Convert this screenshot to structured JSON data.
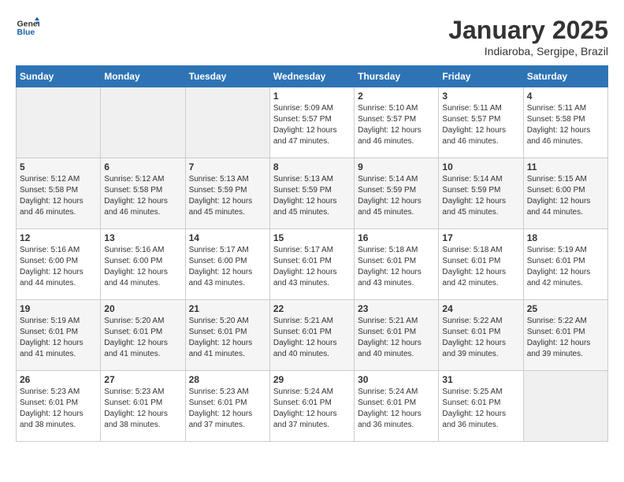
{
  "logo": {
    "text_general": "General",
    "text_blue": "Blue"
  },
  "title": "January 2025",
  "subtitle": "Indiaroba, Sergipe, Brazil",
  "days_of_week": [
    "Sunday",
    "Monday",
    "Tuesday",
    "Wednesday",
    "Thursday",
    "Friday",
    "Saturday"
  ],
  "weeks": [
    [
      {
        "day": "",
        "sunrise": "",
        "sunset": "",
        "daylight": "",
        "empty": true
      },
      {
        "day": "",
        "sunrise": "",
        "sunset": "",
        "daylight": "",
        "empty": true
      },
      {
        "day": "",
        "sunrise": "",
        "sunset": "",
        "daylight": "",
        "empty": true
      },
      {
        "day": "1",
        "sunrise": "Sunrise: 5:09 AM",
        "sunset": "Sunset: 5:57 PM",
        "daylight": "Daylight: 12 hours and 47 minutes.",
        "empty": false
      },
      {
        "day": "2",
        "sunrise": "Sunrise: 5:10 AM",
        "sunset": "Sunset: 5:57 PM",
        "daylight": "Daylight: 12 hours and 46 minutes.",
        "empty": false
      },
      {
        "day": "3",
        "sunrise": "Sunrise: 5:11 AM",
        "sunset": "Sunset: 5:57 PM",
        "daylight": "Daylight: 12 hours and 46 minutes.",
        "empty": false
      },
      {
        "day": "4",
        "sunrise": "Sunrise: 5:11 AM",
        "sunset": "Sunset: 5:58 PM",
        "daylight": "Daylight: 12 hours and 46 minutes.",
        "empty": false
      }
    ],
    [
      {
        "day": "5",
        "sunrise": "Sunrise: 5:12 AM",
        "sunset": "Sunset: 5:58 PM",
        "daylight": "Daylight: 12 hours and 46 minutes.",
        "empty": false
      },
      {
        "day": "6",
        "sunrise": "Sunrise: 5:12 AM",
        "sunset": "Sunset: 5:58 PM",
        "daylight": "Daylight: 12 hours and 46 minutes.",
        "empty": false
      },
      {
        "day": "7",
        "sunrise": "Sunrise: 5:13 AM",
        "sunset": "Sunset: 5:59 PM",
        "daylight": "Daylight: 12 hours and 45 minutes.",
        "empty": false
      },
      {
        "day": "8",
        "sunrise": "Sunrise: 5:13 AM",
        "sunset": "Sunset: 5:59 PM",
        "daylight": "Daylight: 12 hours and 45 minutes.",
        "empty": false
      },
      {
        "day": "9",
        "sunrise": "Sunrise: 5:14 AM",
        "sunset": "Sunset: 5:59 PM",
        "daylight": "Daylight: 12 hours and 45 minutes.",
        "empty": false
      },
      {
        "day": "10",
        "sunrise": "Sunrise: 5:14 AM",
        "sunset": "Sunset: 5:59 PM",
        "daylight": "Daylight: 12 hours and 45 minutes.",
        "empty": false
      },
      {
        "day": "11",
        "sunrise": "Sunrise: 5:15 AM",
        "sunset": "Sunset: 6:00 PM",
        "daylight": "Daylight: 12 hours and 44 minutes.",
        "empty": false
      }
    ],
    [
      {
        "day": "12",
        "sunrise": "Sunrise: 5:16 AM",
        "sunset": "Sunset: 6:00 PM",
        "daylight": "Daylight: 12 hours and 44 minutes.",
        "empty": false
      },
      {
        "day": "13",
        "sunrise": "Sunrise: 5:16 AM",
        "sunset": "Sunset: 6:00 PM",
        "daylight": "Daylight: 12 hours and 44 minutes.",
        "empty": false
      },
      {
        "day": "14",
        "sunrise": "Sunrise: 5:17 AM",
        "sunset": "Sunset: 6:00 PM",
        "daylight": "Daylight: 12 hours and 43 minutes.",
        "empty": false
      },
      {
        "day": "15",
        "sunrise": "Sunrise: 5:17 AM",
        "sunset": "Sunset: 6:01 PM",
        "daylight": "Daylight: 12 hours and 43 minutes.",
        "empty": false
      },
      {
        "day": "16",
        "sunrise": "Sunrise: 5:18 AM",
        "sunset": "Sunset: 6:01 PM",
        "daylight": "Daylight: 12 hours and 43 minutes.",
        "empty": false
      },
      {
        "day": "17",
        "sunrise": "Sunrise: 5:18 AM",
        "sunset": "Sunset: 6:01 PM",
        "daylight": "Daylight: 12 hours and 42 minutes.",
        "empty": false
      },
      {
        "day": "18",
        "sunrise": "Sunrise: 5:19 AM",
        "sunset": "Sunset: 6:01 PM",
        "daylight": "Daylight: 12 hours and 42 minutes.",
        "empty": false
      }
    ],
    [
      {
        "day": "19",
        "sunrise": "Sunrise: 5:19 AM",
        "sunset": "Sunset: 6:01 PM",
        "daylight": "Daylight: 12 hours and 41 minutes.",
        "empty": false
      },
      {
        "day": "20",
        "sunrise": "Sunrise: 5:20 AM",
        "sunset": "Sunset: 6:01 PM",
        "daylight": "Daylight: 12 hours and 41 minutes.",
        "empty": false
      },
      {
        "day": "21",
        "sunrise": "Sunrise: 5:20 AM",
        "sunset": "Sunset: 6:01 PM",
        "daylight": "Daylight: 12 hours and 41 minutes.",
        "empty": false
      },
      {
        "day": "22",
        "sunrise": "Sunrise: 5:21 AM",
        "sunset": "Sunset: 6:01 PM",
        "daylight": "Daylight: 12 hours and 40 minutes.",
        "empty": false
      },
      {
        "day": "23",
        "sunrise": "Sunrise: 5:21 AM",
        "sunset": "Sunset: 6:01 PM",
        "daylight": "Daylight: 12 hours and 40 minutes.",
        "empty": false
      },
      {
        "day": "24",
        "sunrise": "Sunrise: 5:22 AM",
        "sunset": "Sunset: 6:01 PM",
        "daylight": "Daylight: 12 hours and 39 minutes.",
        "empty": false
      },
      {
        "day": "25",
        "sunrise": "Sunrise: 5:22 AM",
        "sunset": "Sunset: 6:01 PM",
        "daylight": "Daylight: 12 hours and 39 minutes.",
        "empty": false
      }
    ],
    [
      {
        "day": "26",
        "sunrise": "Sunrise: 5:23 AM",
        "sunset": "Sunset: 6:01 PM",
        "daylight": "Daylight: 12 hours and 38 minutes.",
        "empty": false
      },
      {
        "day": "27",
        "sunrise": "Sunrise: 5:23 AM",
        "sunset": "Sunset: 6:01 PM",
        "daylight": "Daylight: 12 hours and 38 minutes.",
        "empty": false
      },
      {
        "day": "28",
        "sunrise": "Sunrise: 5:23 AM",
        "sunset": "Sunset: 6:01 PM",
        "daylight": "Daylight: 12 hours and 37 minutes.",
        "empty": false
      },
      {
        "day": "29",
        "sunrise": "Sunrise: 5:24 AM",
        "sunset": "Sunset: 6:01 PM",
        "daylight": "Daylight: 12 hours and 37 minutes.",
        "empty": false
      },
      {
        "day": "30",
        "sunrise": "Sunrise: 5:24 AM",
        "sunset": "Sunset: 6:01 PM",
        "daylight": "Daylight: 12 hours and 36 minutes.",
        "empty": false
      },
      {
        "day": "31",
        "sunrise": "Sunrise: 5:25 AM",
        "sunset": "Sunset: 6:01 PM",
        "daylight": "Daylight: 12 hours and 36 minutes.",
        "empty": false
      },
      {
        "day": "",
        "sunrise": "",
        "sunset": "",
        "daylight": "",
        "empty": true
      }
    ]
  ]
}
